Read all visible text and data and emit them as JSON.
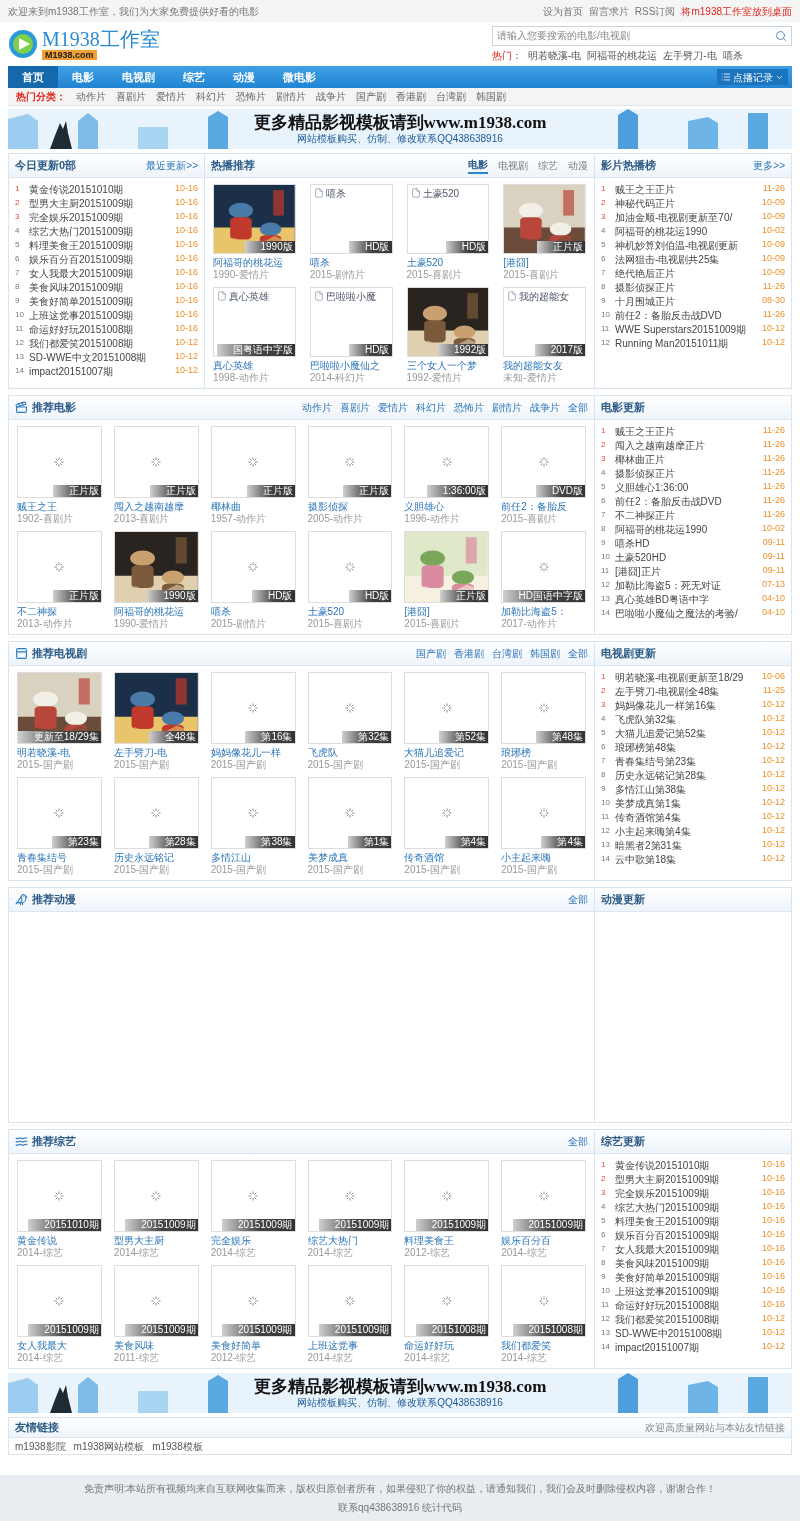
{
  "top_bar": {
    "welcome": "欢迎来到m1938工作室，我们为大家免费提供好看的电影",
    "links": [
      {
        "label": "设为首页",
        "highlight": false
      },
      {
        "label": "留言求片",
        "highlight": false
      },
      {
        "label": "RSS订阅",
        "highlight": false
      },
      {
        "label": "将m1938工作室放到桌面",
        "highlight": true
      }
    ]
  },
  "header": {
    "logo_title": "M1938工作室",
    "logo_domain": "M1938.com",
    "search": {
      "placeholder": "请输入您要搜索的电影/电视剧"
    },
    "hot_label": "热门：",
    "hot_links": [
      "明若晓溪-电",
      "阿福哥的桃花运",
      "左手劈刀-电",
      "嘻杀"
    ]
  },
  "nav": {
    "items": [
      {
        "label": "首页",
        "selected": true
      },
      {
        "label": "电影",
        "selected": false
      },
      {
        "label": "电视剧",
        "selected": false
      },
      {
        "label": "综艺",
        "selected": false
      },
      {
        "label": "动漫",
        "selected": false
      },
      {
        "label": "微电影",
        "selected": false
      }
    ],
    "history_button": "点播记录"
  },
  "categories": {
    "label": "热门分类：",
    "items": [
      "动作片",
      "喜剧片",
      "爱情片",
      "科幻片",
      "恐怖片",
      "剧情片",
      "战争片",
      "国产剧",
      "香港剧",
      "台湾剧",
      "韩国剧"
    ]
  },
  "banners": [
    {
      "headline": "更多精品影视模板请到www.m1938.com",
      "subline": "网站模板购买、仿制、修改联系QQ438638916"
    },
    {
      "headline": "更多精品影视模板请到www.m1938.com",
      "subline": "网站模板购买、仿制、修改联系QQ438638916"
    }
  ],
  "today": {
    "title": "今日更新0部",
    "more": "最近更新>>",
    "items": [
      {
        "rank": "1",
        "title": "黄金传说20151010期",
        "date": "10-16"
      },
      {
        "rank": "2",
        "title": "型男大主厨20151009期",
        "date": "10-16"
      },
      {
        "rank": "3",
        "title": "完全娱乐20151009期",
        "date": "10-16"
      },
      {
        "rank": "4",
        "title": "综艺大热门20151009期",
        "date": "10-16"
      },
      {
        "rank": "5",
        "title": "料理美食王20151009期",
        "date": "10-16"
      },
      {
        "rank": "6",
        "title": "娱乐百分百20151009期",
        "date": "10-16"
      },
      {
        "rank": "7",
        "title": "女人我最大20151009期",
        "date": "10-16"
      },
      {
        "rank": "8",
        "title": "美食风味20151009期",
        "date": "10-16"
      },
      {
        "rank": "9",
        "title": "美食好简单20151009期",
        "date": "10-16"
      },
      {
        "rank": "10",
        "title": "上班这党事20151009期",
        "date": "10-16"
      },
      {
        "rank": "11",
        "title": "命运好好玩20151008期",
        "date": "10-16"
      },
      {
        "rank": "12",
        "title": "我们都爱笑20151008期",
        "date": "10-12"
      },
      {
        "rank": "13",
        "title": "SD-WWE中文20151008期",
        "date": "10-12"
      },
      {
        "rank": "14",
        "title": "impact20151007期",
        "date": "10-12"
      }
    ]
  },
  "hot": {
    "title": "热播推荐",
    "tabs": [
      {
        "label": "电影",
        "selected": true
      },
      {
        "label": "电视剧",
        "selected": false
      },
      {
        "label": "综艺",
        "selected": false
      },
      {
        "label": "动漫",
        "selected": false
      }
    ],
    "cards": [
      {
        "kind": "poster",
        "badge": "1990版",
        "title": "阿福哥的桃花运",
        "meta": "1990-爱情片"
      },
      {
        "kind": "broken",
        "alt": "嘻杀",
        "badge": "HD版",
        "title": "嘻杀",
        "meta": "2015-剧情片"
      },
      {
        "kind": "broken",
        "alt": "土豪520",
        "badge": "HD版",
        "title": "土豪520",
        "meta": "2015-喜剧片"
      },
      {
        "kind": "poster",
        "badge": "正片版",
        "title": "[港囧]",
        "meta": "2015-喜剧片"
      },
      {
        "kind": "broken",
        "alt": "真心英雄",
        "badge": "国粤语中字版",
        "title": "真心英雄",
        "meta": "1998-动作片"
      },
      {
        "kind": "broken",
        "alt": "巴啦啦小魔",
        "badge": "HD版",
        "title": "巴啦啦小魔仙之",
        "meta": "2014-科幻片"
      },
      {
        "kind": "poster",
        "badge": "1992版",
        "title": "三个女人一个梦",
        "meta": "1992-爱情片"
      },
      {
        "kind": "broken",
        "alt": "我的超能女",
        "badge": "2017版",
        "title": "我的超能女友",
        "meta": "未知-爱情片"
      }
    ]
  },
  "ranking": {
    "title": "影片热播榜",
    "more": "更多>>",
    "items": [
      {
        "rank": "1",
        "title": "贼王之王正片",
        "date": "11-26"
      },
      {
        "rank": "2",
        "title": "神秘代码正片",
        "date": "10-09"
      },
      {
        "rank": "3",
        "title": "加油金顺-电视剧更新至70/",
        "date": "10-09"
      },
      {
        "rank": "4",
        "title": "阿福哥的桃花运1990",
        "date": "10-02"
      },
      {
        "rank": "5",
        "title": "神机妙算刘伯温-电视剧更新",
        "date": "10-09"
      },
      {
        "rank": "6",
        "title": "法网狙击-电视剧共25集",
        "date": "10-09"
      },
      {
        "rank": "7",
        "title": "绝代艳后正片",
        "date": "10-09"
      },
      {
        "rank": "8",
        "title": "摄影侦探正片",
        "date": "11-26"
      },
      {
        "rank": "9",
        "title": "十月围城正片",
        "date": "08-30"
      },
      {
        "rank": "10",
        "title": "前任2：备胎反击战DVD",
        "date": "11-26"
      },
      {
        "rank": "11",
        "title": "WWE Superstars20151009期",
        "date": "10-12"
      },
      {
        "rank": "12",
        "title": "Running Man20151011期",
        "date": "10-12"
      }
    ]
  },
  "sections": [
    {
      "kind": "movie",
      "title": "推荐电影",
      "filters": [
        "动作片",
        "喜剧片",
        "爱情片",
        "科幻片",
        "恐怖片",
        "剧情片",
        "战争片",
        "全部"
      ],
      "cards": [
        {
          "kind": "loading",
          "badge": "正片版",
          "title": "贼王之王",
          "meta": "1902-喜剧片"
        },
        {
          "kind": "loading",
          "badge": "正片版",
          "title": "闯入之越南越摩",
          "meta": "2013-喜剧片"
        },
        {
          "kind": "loading",
          "badge": "正片版",
          "title": "椰林曲",
          "meta": "1957-动作片"
        },
        {
          "kind": "loading",
          "badge": "正片版",
          "title": "摄影侦探",
          "meta": "2005-动作片"
        },
        {
          "kind": "loading",
          "badge": "1:36:00版",
          "title": "义胆雄心",
          "meta": "1996-动作片"
        },
        {
          "kind": "loading",
          "badge": "DVD版",
          "title": "前任2：备胎反",
          "meta": "2015-喜剧片"
        },
        {
          "kind": "loading",
          "badge": "正片版",
          "title": "不二神探",
          "meta": "2013-动作片"
        },
        {
          "kind": "poster",
          "badge": "1990版",
          "title": "阿福哥的桃花运",
          "meta": "1990-爱情片"
        },
        {
          "kind": "loading",
          "badge": "HD版",
          "title": "嘻杀",
          "meta": "2015-剧情片"
        },
        {
          "kind": "loading",
          "badge": "HD版",
          "title": "土豪520",
          "meta": "2015-喜剧片"
        },
        {
          "kind": "poster",
          "badge": "正片版",
          "title": "[港囧]",
          "meta": "2015-喜剧片"
        },
        {
          "kind": "loading",
          "badge": "HD国语中字版",
          "title": "加勒比海盗5：",
          "meta": "2017-动作片"
        }
      ],
      "side": {
        "title": "电影更新",
        "items": [
          {
            "rank": "1",
            "title": "贼王之王正片",
            "date": "11-26"
          },
          {
            "rank": "2",
            "title": "闯入之越南越摩正片",
            "date": "11-26"
          },
          {
            "rank": "3",
            "title": "椰林曲正片",
            "date": "11-26"
          },
          {
            "rank": "4",
            "title": "摄影侦探正片",
            "date": "11-26"
          },
          {
            "rank": "5",
            "title": "义胆雄心1:36:00",
            "date": "11-26"
          },
          {
            "rank": "6",
            "title": "前任2：备胎反击战DVD",
            "date": "11-26"
          },
          {
            "rank": "7",
            "title": "不二神探正片",
            "date": "11-26"
          },
          {
            "rank": "8",
            "title": "阿福哥的桃花运1990",
            "date": "10-02"
          },
          {
            "rank": "9",
            "title": "嘻杀HD",
            "date": "09-11"
          },
          {
            "rank": "10",
            "title": "土豪520HD",
            "date": "09-11"
          },
          {
            "rank": "11",
            "title": "[港囧]正片",
            "date": "09-11"
          },
          {
            "rank": "12",
            "title": "加勒比海盗5：死无对证",
            "date": "07-13"
          },
          {
            "rank": "13",
            "title": "真心英雄BD粤语中字",
            "date": "04-10"
          },
          {
            "rank": "14",
            "title": "巴啦啦小魔仙之魔法的考验/",
            "date": "04-10"
          }
        ]
      }
    },
    {
      "kind": "tv",
      "title": "推荐电视剧",
      "filters": [
        "国产剧",
        "香港剧",
        "台湾剧",
        "韩国剧",
        "全部"
      ],
      "cards": [
        {
          "kind": "poster",
          "badge": "更新至18/29集",
          "title": "明若晓溪-电",
          "meta": "2015-国产剧"
        },
        {
          "kind": "poster",
          "badge": "全48集",
          "title": "左手劈刀-电",
          "meta": "2015-国产剧"
        },
        {
          "kind": "loading",
          "badge": "第16集",
          "title": "妈妈像花儿一样",
          "meta": "2015-国产剧"
        },
        {
          "kind": "loading",
          "badge": "第32集",
          "title": "飞虎队",
          "meta": "2015-国产剧"
        },
        {
          "kind": "loading",
          "badge": "第52集",
          "title": "大猫儿追爱记",
          "meta": "2015-国产剧"
        },
        {
          "kind": "loading",
          "badge": "第48集",
          "title": "琅琊榜",
          "meta": "2015-国产剧"
        },
        {
          "kind": "loading",
          "badge": "第23集",
          "title": "青春集结号",
          "meta": "2015-国产剧"
        },
        {
          "kind": "loading",
          "badge": "第28集",
          "title": "历史永远铭记",
          "meta": "2015-国产剧"
        },
        {
          "kind": "loading",
          "badge": "第38集",
          "title": "多情江山",
          "meta": "2015-国产剧"
        },
        {
          "kind": "loading",
          "badge": "第1集",
          "title": "美梦成真",
          "meta": "2015-国产剧"
        },
        {
          "kind": "loading",
          "badge": "第4集",
          "title": "传奇酒馆",
          "meta": "2015-国产剧"
        },
        {
          "kind": "loading",
          "badge": "第4集",
          "title": "小主起来嗨",
          "meta": "2015-国产剧"
        }
      ],
      "side": {
        "title": "电视剧更新",
        "items": [
          {
            "rank": "1",
            "title": "明若晓溪-电视剧更新至18/29",
            "date": "10-06"
          },
          {
            "rank": "2",
            "title": "左手劈刀-电视剧全48集",
            "date": "11-25"
          },
          {
            "rank": "3",
            "title": "妈妈像花儿一样第16集",
            "date": "10-12"
          },
          {
            "rank": "4",
            "title": "飞虎队第32集",
            "date": "10-12"
          },
          {
            "rank": "5",
            "title": "大猫儿追爱记第52集",
            "date": "10-12"
          },
          {
            "rank": "6",
            "title": "琅琊榜第48集",
            "date": "10-12"
          },
          {
            "rank": "7",
            "title": "青春集结号第23集",
            "date": "10-12"
          },
          {
            "rank": "8",
            "title": "历史永远铭记第28集",
            "date": "10-12"
          },
          {
            "rank": "9",
            "title": "多情江山第38集",
            "date": "10-12"
          },
          {
            "rank": "10",
            "title": "美梦成真第1集",
            "date": "10-12"
          },
          {
            "rank": "11",
            "title": "传奇酒馆第4集",
            "date": "10-12"
          },
          {
            "rank": "12",
            "title": "小主起来嗨第4集",
            "date": "10-12"
          },
          {
            "rank": "13",
            "title": "暗黑者2第31集",
            "date": "10-12"
          },
          {
            "rank": "14",
            "title": "云中歌第18集",
            "date": "10-12"
          }
        ]
      }
    },
    {
      "kind": "anime",
      "title": "推荐动漫",
      "filters": [
        "全部"
      ],
      "side": {
        "title": "动漫更新"
      }
    },
    {
      "kind": "variety",
      "title": "推荐综艺",
      "filters": [
        "全部"
      ],
      "cards": [
        {
          "kind": "loading",
          "badge": "20151010期",
          "title": "黄金传说",
          "meta": "2014-综艺"
        },
        {
          "kind": "loading",
          "badge": "20151009期",
          "title": "型男大主厨",
          "meta": "2014-综艺"
        },
        {
          "kind": "loading",
          "badge": "20151009期",
          "title": "完全娱乐",
          "meta": "2014-综艺"
        },
        {
          "kind": "loading",
          "badge": "20151009期",
          "title": "综艺大热门",
          "meta": "2014-综艺"
        },
        {
          "kind": "loading",
          "badge": "20151009期",
          "title": "料理美食王",
          "meta": "2012-综艺"
        },
        {
          "kind": "loading",
          "badge": "20151009期",
          "title": "娱乐百分百",
          "meta": "2014-综艺"
        },
        {
          "kind": "loading",
          "badge": "20151009期",
          "title": "女人我最大",
          "meta": "2014-综艺"
        },
        {
          "kind": "loading",
          "badge": "20151009期",
          "title": "美食风味",
          "meta": "2011-综艺"
        },
        {
          "kind": "loading",
          "badge": "20151009期",
          "title": "美食好简单",
          "meta": "2012-综艺"
        },
        {
          "kind": "loading",
          "badge": "20151009期",
          "title": "上班这党事",
          "meta": "2014-综艺"
        },
        {
          "kind": "loading",
          "badge": "20151008期",
          "title": "命运好好玩",
          "meta": "2014-综艺"
        },
        {
          "kind": "loading",
          "badge": "20151008期",
          "title": "我们都爱笑",
          "meta": "2014-综艺"
        }
      ],
      "side": {
        "title": "综艺更新",
        "items": [
          {
            "rank": "1",
            "title": "黄金传说20151010期",
            "date": "10-16"
          },
          {
            "rank": "2",
            "title": "型男大主厨20151009期",
            "date": "10-16"
          },
          {
            "rank": "3",
            "title": "完全娱乐20151009期",
            "date": "10-16"
          },
          {
            "rank": "4",
            "title": "综艺大热门20151009期",
            "date": "10-16"
          },
          {
            "rank": "5",
            "title": "料理美食王20151009期",
            "date": "10-16"
          },
          {
            "rank": "6",
            "title": "娱乐百分百20151009期",
            "date": "10-16"
          },
          {
            "rank": "7",
            "title": "女人我最大20151009期",
            "date": "10-16"
          },
          {
            "rank": "8",
            "title": "美食风味20151009期",
            "date": "10-16"
          },
          {
            "rank": "9",
            "title": "美食好简单20151009期",
            "date": "10-16"
          },
          {
            "rank": "10",
            "title": "上班这党事20151009期",
            "date": "10-16"
          },
          {
            "rank": "11",
            "title": "命运好好玩20151008期",
            "date": "10-16"
          },
          {
            "rank": "12",
            "title": "我们都爱笑20151008期",
            "date": "10-12"
          },
          {
            "rank": "13",
            "title": "SD-WWE中20151008期",
            "date": "10-12"
          },
          {
            "rank": "14",
            "title": "impact20151007期",
            "date": "10-12"
          }
        ]
      }
    }
  ],
  "friend_links": {
    "title": "友情链接",
    "note": "欢迎高质量网站与本站友情链接",
    "links": [
      "m1938影院",
      "m1938网站模板",
      "m1938模板"
    ]
  },
  "footer": {
    "disclaimer": "免责声明:本站所有视频均来自互联网收集而来，版权归原创者所有，如果侵犯了你的权益，请通知我们，我们会及时删除侵权内容，谢谢合作！",
    "contact": "联系qq438638916 统计代码"
  }
}
